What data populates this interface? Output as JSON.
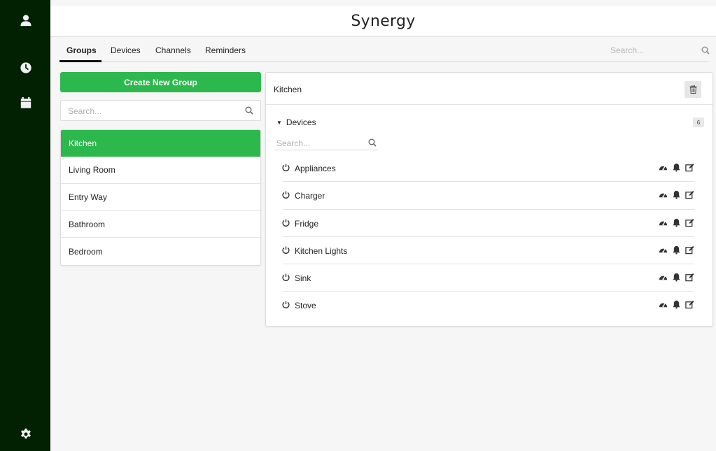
{
  "app": {
    "title": "Synergy"
  },
  "sidebar": {
    "items": [
      {
        "icon": "user-icon"
      },
      {
        "icon": "clock-icon"
      },
      {
        "icon": "calendar-icon"
      },
      {
        "icon": "gear-icon"
      }
    ]
  },
  "tabs": [
    {
      "label": "Groups",
      "active": true
    },
    {
      "label": "Devices"
    },
    {
      "label": "Channels"
    },
    {
      "label": "Reminders"
    }
  ],
  "top_search": {
    "placeholder": "Search..."
  },
  "groups": {
    "create_label": "Create New Group",
    "search_placeholder": "Search...",
    "items": [
      {
        "label": "Kitchen",
        "active": true
      },
      {
        "label": "Living Room"
      },
      {
        "label": "Entry Way"
      },
      {
        "label": "Bathroom"
      },
      {
        "label": "Bedroom"
      }
    ]
  },
  "group_detail": {
    "title": "Kitchen",
    "devices_label": "Devices",
    "devices_count": "6",
    "search_placeholder": "Search...",
    "devices": [
      {
        "name": "Appliances"
      },
      {
        "name": "Charger"
      },
      {
        "name": "Fridge"
      },
      {
        "name": "Kitchen Lights"
      },
      {
        "name": "Sink"
      },
      {
        "name": "Stove"
      }
    ]
  },
  "colors": {
    "sidebar_bg": "#022102",
    "accent_green": "#2db84d"
  }
}
